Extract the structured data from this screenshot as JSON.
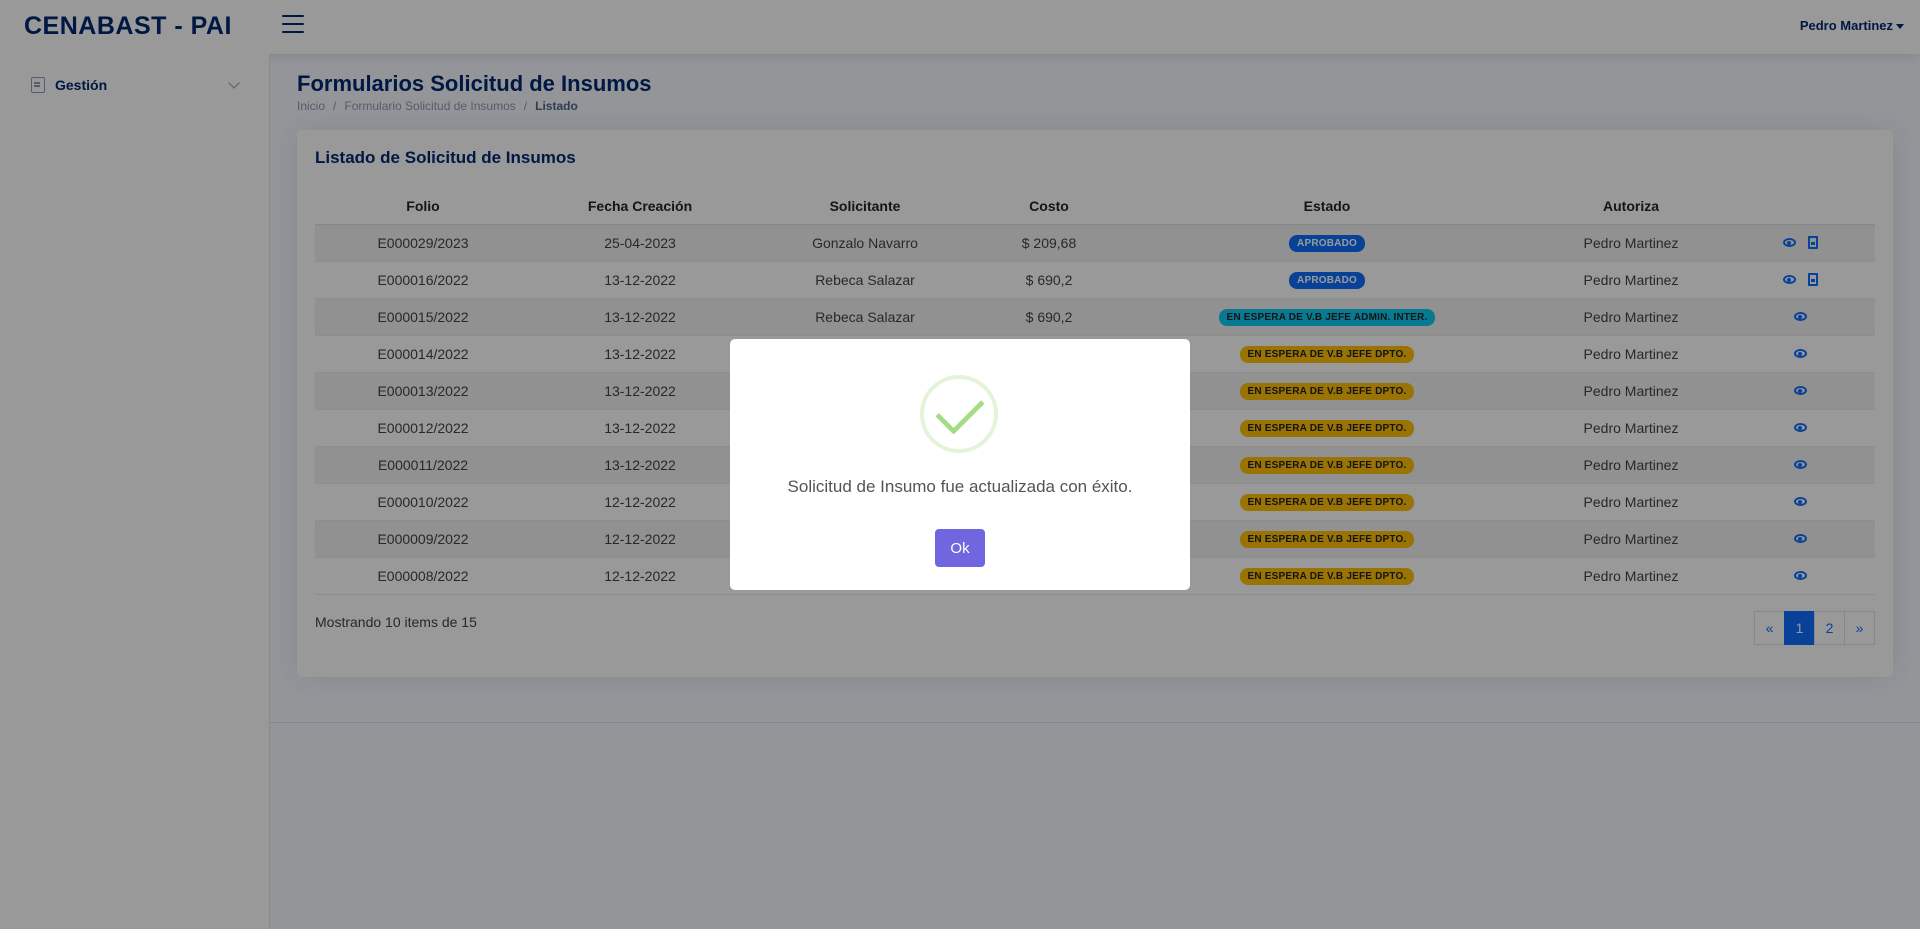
{
  "header": {
    "logo": "CENABAST - PAI",
    "user": "Pedro Martinez"
  },
  "sidebar": {
    "items": [
      {
        "label": "Gestión"
      }
    ]
  },
  "page": {
    "title": "Formularios Solicitud de Insumos",
    "breadcrumb": [
      "Inicio",
      "Formulario Solicitud de Insumos",
      "Listado"
    ]
  },
  "card": {
    "title": "Listado de Solicitud de Insumos",
    "columns": [
      "Folio",
      "Fecha Creación",
      "Solicitante",
      "Costo",
      "Estado",
      "Autoriza",
      ""
    ],
    "rows": [
      {
        "folio": "E000029/2023",
        "fecha": "25-04-2023",
        "solicitante": "Gonzalo Navarro",
        "costo": "$ 209,68",
        "estado": "APROBADO",
        "estado_type": "blue",
        "autoriza": "Pedro Martinez",
        "pdf": true
      },
      {
        "folio": "E000016/2022",
        "fecha": "13-12-2022",
        "solicitante": "Rebeca Salazar",
        "costo": "$ 690,2",
        "estado": "APROBADO",
        "estado_type": "blue",
        "autoriza": "Pedro Martinez",
        "pdf": true
      },
      {
        "folio": "E000015/2022",
        "fecha": "13-12-2022",
        "solicitante": "Rebeca Salazar",
        "costo": "$ 690,2",
        "estado": "EN ESPERA DE V.B JEFE ADMIN. INTER.",
        "estado_type": "cyan",
        "autoriza": "Pedro Martinez",
        "pdf": false
      },
      {
        "folio": "E000014/2022",
        "fecha": "13-12-2022",
        "solicitante": "",
        "costo": "",
        "estado": "EN ESPERA DE V.B JEFE DPTO.",
        "estado_type": "yellow",
        "autoriza": "Pedro Martinez",
        "pdf": false
      },
      {
        "folio": "E000013/2022",
        "fecha": "13-12-2022",
        "solicitante": "",
        "costo": "",
        "estado": "EN ESPERA DE V.B JEFE DPTO.",
        "estado_type": "yellow",
        "autoriza": "Pedro Martinez",
        "pdf": false
      },
      {
        "folio": "E000012/2022",
        "fecha": "13-12-2022",
        "solicitante": "",
        "costo": "",
        "estado": "EN ESPERA DE V.B JEFE DPTO.",
        "estado_type": "yellow",
        "autoriza": "Pedro Martinez",
        "pdf": false
      },
      {
        "folio": "E000011/2022",
        "fecha": "13-12-2022",
        "solicitante": "",
        "costo": "",
        "estado": "EN ESPERA DE V.B JEFE DPTO.",
        "estado_type": "yellow",
        "autoriza": "Pedro Martinez",
        "pdf": false
      },
      {
        "folio": "E000010/2022",
        "fecha": "12-12-2022",
        "solicitante": "",
        "costo": "",
        "estado": "EN ESPERA DE V.B JEFE DPTO.",
        "estado_type": "yellow",
        "autoriza": "Pedro Martinez",
        "pdf": false
      },
      {
        "folio": "E000009/2022",
        "fecha": "12-12-2022",
        "solicitante": "",
        "costo": "",
        "estado": "EN ESPERA DE V.B JEFE DPTO.",
        "estado_type": "yellow",
        "autoriza": "Pedro Martinez",
        "pdf": false
      },
      {
        "folio": "E000008/2022",
        "fecha": "12-12-2022",
        "solicitante": "",
        "costo": "",
        "estado": "EN ESPERA DE V.B JEFE DPTO.",
        "estado_type": "yellow",
        "autoriza": "Pedro Martinez",
        "pdf": false
      }
    ],
    "showing": "Mostrando 10 items de 15",
    "pagination": [
      "«",
      "1",
      "2",
      "»"
    ],
    "active_page": "1"
  },
  "modal": {
    "message": "Solicitud de Insumo fue actualizada con éxito.",
    "ok_label": "Ok"
  },
  "colors": {
    "brand": "#012970",
    "primary": "#0d6efd",
    "confirm": "#7066e0",
    "success": "#a5dc86"
  }
}
